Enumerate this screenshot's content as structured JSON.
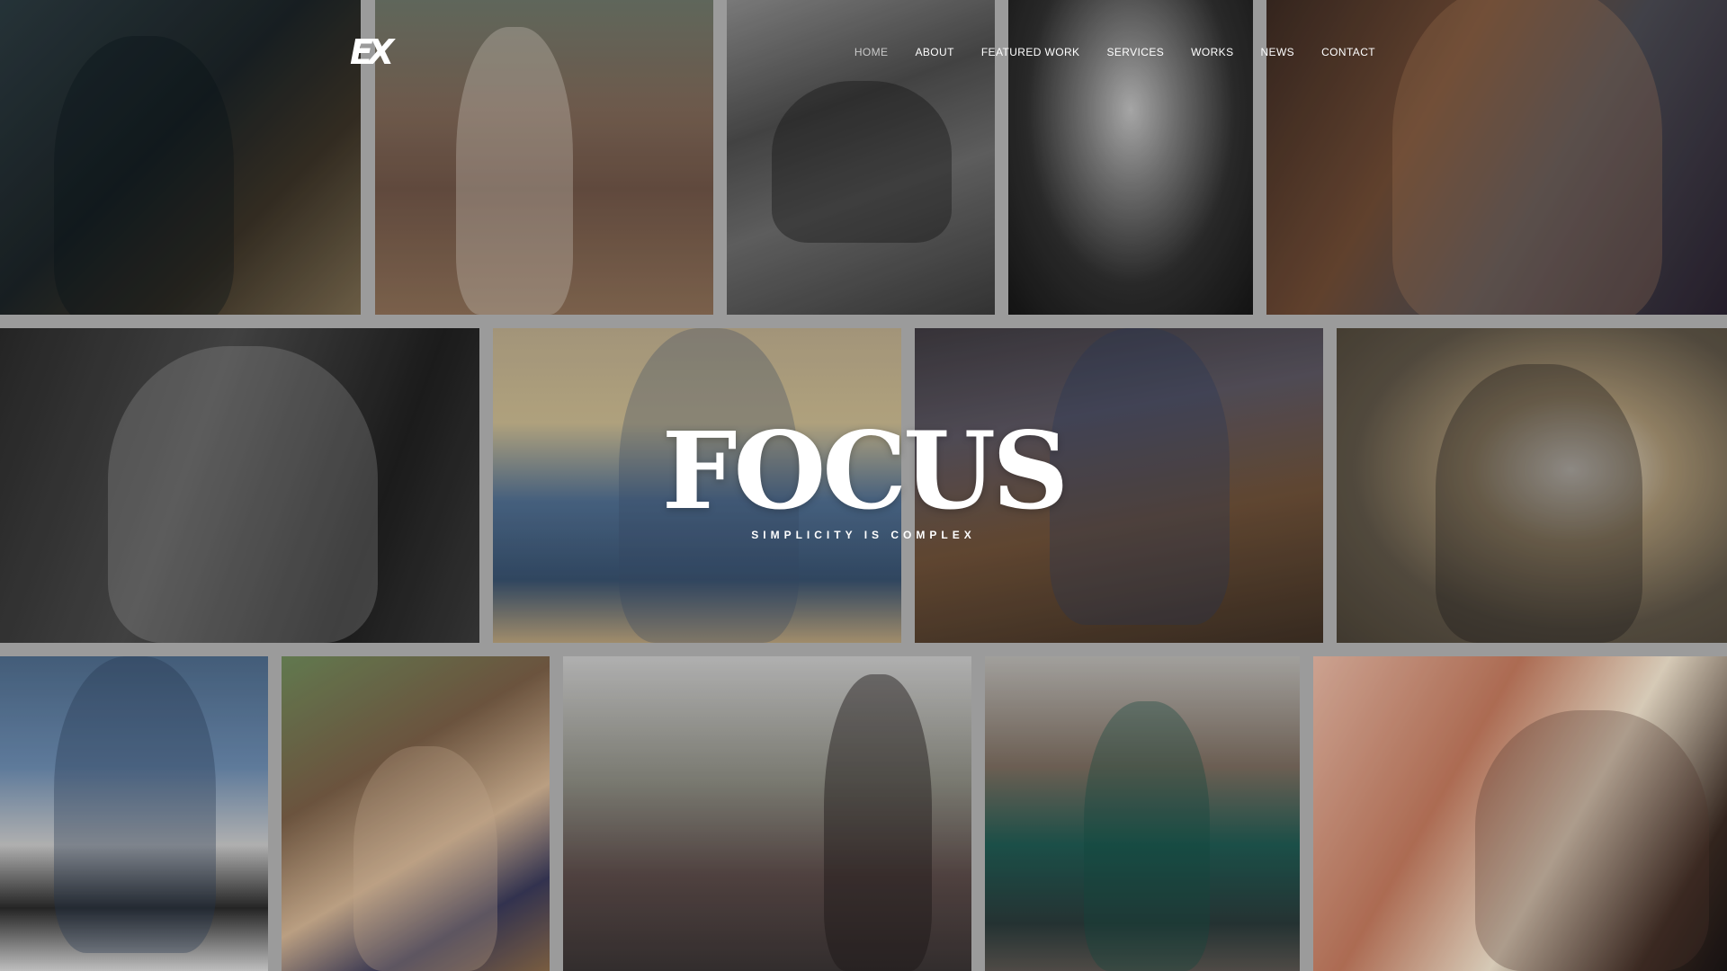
{
  "site": {
    "logo_text": "EX"
  },
  "nav": {
    "items": [
      {
        "label": "HOME",
        "active": true
      },
      {
        "label": "ABOUT",
        "active": false
      },
      {
        "label": "FEATURED WORK",
        "active": false
      },
      {
        "label": "SERVICES",
        "active": false
      },
      {
        "label": "WORKS",
        "active": false
      },
      {
        "label": "NEWS",
        "active": false
      },
      {
        "label": "CONTACT",
        "active": false
      }
    ]
  },
  "hero": {
    "title": "FOCUS",
    "subtitle": "SIMPLICITY IS COMPLEX"
  },
  "gallery": {
    "background_color": "#9b9b9b"
  }
}
